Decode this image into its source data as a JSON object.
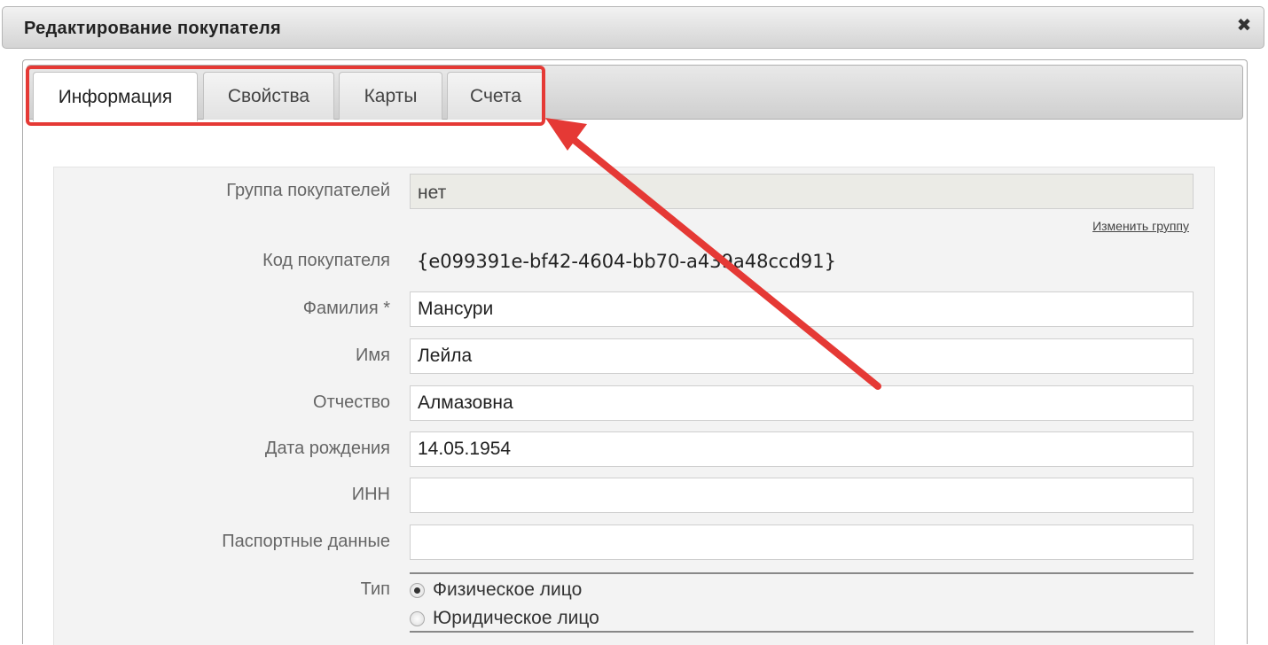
{
  "dialog": {
    "title": "Редактирование покупателя",
    "close_icon": "close-icon"
  },
  "tabs": [
    {
      "label": "Информация",
      "active": true
    },
    {
      "label": "Свойства",
      "active": false
    },
    {
      "label": "Карты",
      "active": false
    },
    {
      "label": "Счета",
      "active": false
    }
  ],
  "form": {
    "group": {
      "label": "Группа покупателей",
      "value": "нет",
      "change_link": "Изменить группу"
    },
    "code": {
      "label": "Код покупателя",
      "value": "{e099391e-bf42-4604-bb70-a439a48ccd91}"
    },
    "last_name": {
      "label": "Фамилия *",
      "value": "Мансури"
    },
    "first_name": {
      "label": "Имя",
      "value": "Лейла"
    },
    "patronymic": {
      "label": "Отчество",
      "value": "Алмазовна"
    },
    "birth_date": {
      "label": "Дата рождения",
      "value": "14.05.1954"
    },
    "inn": {
      "label": "ИНН",
      "value": ""
    },
    "passport": {
      "label": "Паспортные данные",
      "value": ""
    },
    "type": {
      "label": "Тип",
      "options": [
        {
          "label": "Физическое лицо",
          "checked": true
        },
        {
          "label": "Юридическое лицо",
          "checked": false
        }
      ]
    }
  },
  "annotation": {
    "color": "#e53935"
  }
}
